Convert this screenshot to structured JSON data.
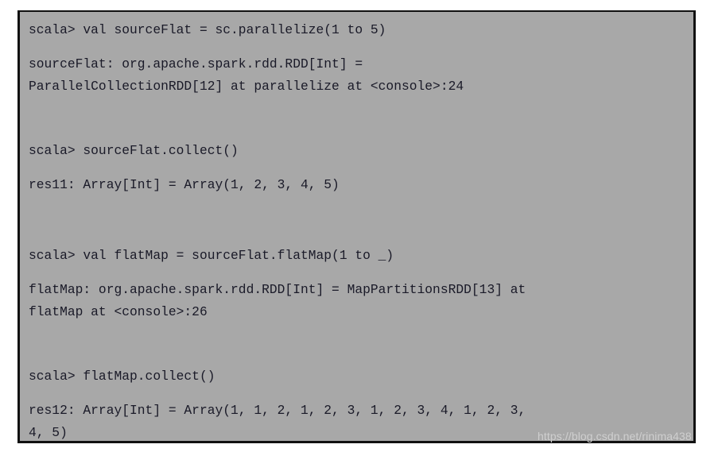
{
  "terminal": {
    "background_color": "#a8a8a8",
    "text_color": "#1a1a28",
    "border_color": "#111111",
    "blocks": [
      {
        "prompt": "scala> val sourceFlat = sc.parallelize(1 to 5)",
        "output_lines": [
          "sourceFlat: org.apache.spark.rdd.RDD[Int] =",
          "ParallelCollectionRDD[12] at parallelize at <console>:24"
        ]
      },
      {
        "prompt": "scala> sourceFlat.collect()",
        "output_lines": [
          "res11: Array[Int] = Array(1, 2, 3, 4, 5)"
        ]
      },
      {
        "prompt": "scala> val flatMap = sourceFlat.flatMap(1 to _)",
        "output_lines": [
          "flatMap: org.apache.spark.rdd.RDD[Int] = MapPartitionsRDD[13] at",
          "flatMap at <console>:26"
        ]
      },
      {
        "prompt": "scala> flatMap.collect()",
        "output_lines": [
          "res12: Array[Int] = Array(1, 1, 2, 1, 2, 3, 1, 2, 3, 4, 1, 2, 3,",
          "4, 5)"
        ]
      }
    ]
  },
  "watermark": {
    "text": "https://blog.csdn.net/rinima438"
  }
}
